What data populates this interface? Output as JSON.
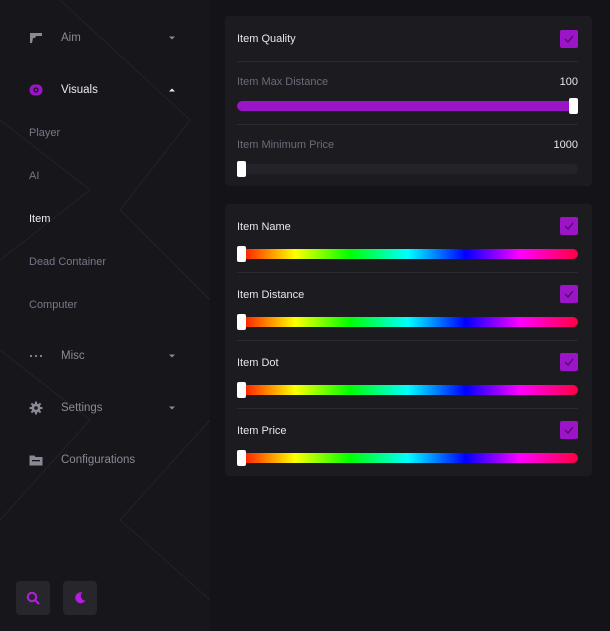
{
  "sidebar": {
    "items": [
      {
        "label": "Aim",
        "icon": "gun-icon",
        "expanded": false
      },
      {
        "label": "Visuals",
        "icon": "eye-icon",
        "expanded": true
      },
      {
        "label": "Misc",
        "icon": "dots-icon",
        "expanded": false
      },
      {
        "label": "Settings",
        "icon": "gear-icon",
        "expanded": false
      },
      {
        "label": "Configurations",
        "icon": "folder-icon",
        "expanded": false
      }
    ],
    "sub_items": [
      {
        "label": "Player",
        "active": false
      },
      {
        "label": "AI",
        "active": false
      },
      {
        "label": "Item",
        "active": true
      },
      {
        "label": "Dead Container",
        "active": false
      },
      {
        "label": "Computer",
        "active": false
      }
    ],
    "bottom_buttons": [
      {
        "icon": "search-icon"
      },
      {
        "icon": "moon-icon"
      }
    ]
  },
  "settings": {
    "item_quality": {
      "label": "Item Quality",
      "checked": true
    },
    "max_distance": {
      "label": "Item Max Distance",
      "value": "100",
      "fraction": 1.0
    },
    "min_price": {
      "label": "Item Minimum Price",
      "value": "1000",
      "fraction": 0.0
    }
  },
  "colors_section": [
    {
      "label": "Item Name",
      "checked": true,
      "hue": 0
    },
    {
      "label": "Item Distance",
      "checked": true,
      "hue": 0
    },
    {
      "label": "Item Dot",
      "checked": true,
      "hue": 0
    },
    {
      "label": "Item Price",
      "checked": true,
      "hue": 0
    }
  ],
  "colors": {
    "accent": "#9b14c8",
    "background": "#141418",
    "panel": "#1b1b20"
  }
}
